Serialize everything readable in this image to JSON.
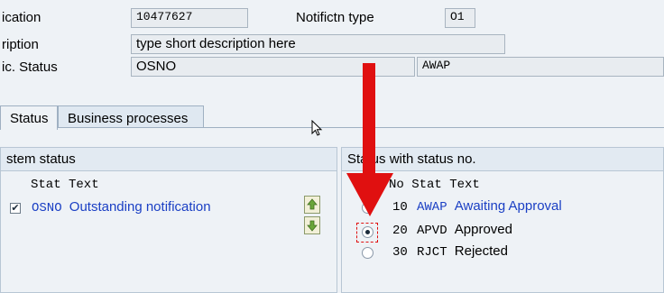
{
  "header": {
    "notification_label": "ication",
    "notification_value": "10477627",
    "notif_type_label": "Notifictn type",
    "notif_type_value": "O1",
    "description_label": "ription",
    "description_value": "type short description here",
    "status_label": "ic. Status",
    "status_value": "OSNO",
    "status_value2": "AWAP"
  },
  "tabs": [
    {
      "label": "Status",
      "active": true
    },
    {
      "label": "Business processes",
      "active": false
    }
  ],
  "system_status": {
    "title": "stem status",
    "columns": "Stat Text",
    "rows": [
      {
        "checked": true,
        "stat": "OSNO",
        "text": "Outstanding notification"
      }
    ]
  },
  "user_status": {
    "title": "Status with status no.",
    "columns": "No Stat Text",
    "rows": [
      {
        "no": "10",
        "stat": "AWAP",
        "text": "Awaiting Approval",
        "selected": false
      },
      {
        "no": "20",
        "stat": "APVD",
        "text": "Approved",
        "selected": true
      },
      {
        "no": "30",
        "stat": "RJCT",
        "text": "Rejected",
        "selected": false
      }
    ]
  },
  "icons": {
    "move_up": "move-up-icon",
    "move_down": "move-down-icon",
    "arrow": "red-arrow-annotation",
    "cursor": "mouse-cursor-icon"
  },
  "colors": {
    "arrow": "#e01010",
    "link_text": "#1a3fc4",
    "background": "#eef2f6"
  }
}
